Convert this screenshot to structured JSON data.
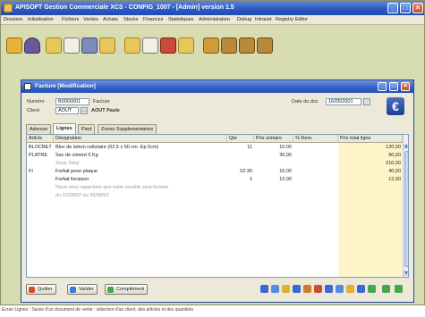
{
  "app": {
    "title": "APISOFT Gestion Commerciale XCS - CONFIG_1007 - [Admin] version 1.5",
    "window_controls": [
      "_",
      "□",
      "×"
    ]
  },
  "menu": [
    "Dossiers",
    "Initialisation",
    "Fichiers",
    "Ventes",
    "Achats",
    "Stocks",
    "Finances",
    "Statistiques",
    "Administration",
    "Debug",
    "Intranet",
    "Registry Editor"
  ],
  "toolbar": {
    "icons": [
      "warning-icon",
      "user-icon",
      "folder-icon",
      "document-icon",
      "printer-icon",
      "folder-icon",
      "folder-icon",
      "document-icon",
      "chart-icon",
      "folder-icon",
      "settings-icon",
      "group-icon",
      "group-icon",
      "group-icon"
    ]
  },
  "document_window": {
    "title": "Facture [Modification]",
    "window_controls": [
      "_",
      "□",
      "×"
    ],
    "numero_label": "Numéro",
    "numero_value": "B0000001",
    "type_value": "Facture",
    "client_label": "Client",
    "client_code": "AOUT",
    "client_name": "AOUT Paule",
    "date_label": "Date du doc",
    "date_value": "16/05/2001",
    "currency_symbol": "€"
  },
  "tabs": [
    {
      "label": "Adresse",
      "active": false
    },
    {
      "label": "Lignes",
      "active": true
    },
    {
      "label": "Pied",
      "active": false
    },
    {
      "label": "Zones Supplementaires",
      "active": false
    }
  ],
  "grid": {
    "columns": [
      "Article",
      "Désignation",
      "Qte",
      "Prix unitaire",
      "% Rem.",
      "Prix total ligne"
    ],
    "rows": [
      {
        "article": "BLOCBET",
        "designation": "Bloc de béton cellulaire (62,5 x 50 cm. Ep 5cm)",
        "qte": "11",
        "prix": "10,00",
        "rem": "",
        "total": "120,00",
        "grey": false
      },
      {
        "article": "PLATRE",
        "designation": "Sac de ciment 5 Kg",
        "qte": "",
        "prix": "30,00",
        "rem": "",
        "total": "90,00",
        "grey": false
      },
      {
        "article": "",
        "designation": "Sous-Total",
        "qte": "",
        "prix": "",
        "rem": "",
        "total": "210,00",
        "grey": true
      },
      {
        "article": "FI",
        "designation": "Forfait pose plaque",
        "qte": "02:30",
        "prix": "16,00",
        "rem": "",
        "total": "40,00",
        "grey": false
      },
      {
        "article": "",
        "designation": "Forfait livraison",
        "qte": "1",
        "prix": "12,00",
        "rem": "",
        "total": "12,00",
        "grey": false
      },
      {
        "article": "",
        "designation": "Nous vous rappelons que notre société sera fermée",
        "qte": "",
        "prix": "",
        "rem": "",
        "total": "",
        "grey": true
      },
      {
        "article": "",
        "designation": "du 01/08/02 au 30/08/02",
        "qte": "",
        "prix": "",
        "rem": "",
        "total": "",
        "grey": true
      }
    ]
  },
  "buttons": {
    "quit": "Quitter",
    "validate": "Valider",
    "complement": "Complément"
  },
  "colors": {
    "titlebar": "#2d5bc3",
    "background": "#d7dcb1",
    "total_column": "#fdf5c9"
  },
  "caption": "Écran Lignes : Saisie d'un document de vente : sélection d'un client, des articles et des quantités"
}
